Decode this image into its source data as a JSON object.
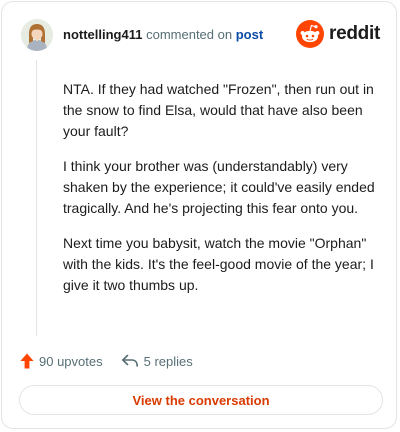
{
  "header": {
    "username": "nottelling411",
    "action_text": "commented on",
    "post_link_label": "post",
    "avatar_icon": "avatar-icon"
  },
  "brand": {
    "wordmark": "reddit",
    "logo_icon": "reddit-alien-logo-icon",
    "color": "#ff4500"
  },
  "comment": {
    "paragraphs": [
      "NTA. If they had watched \"Frozen\", then run out in the snow to find Elsa, would that have also been your fault?",
      "I think your brother was (understandably) very shaken by the experience; it could've easily ended tragically. And he's projecting this fear onto you.",
      "Next time you babysit, watch the movie \"Orphan\" with the kids. It's the feel-good movie of the year; I give it two thumbs up."
    ]
  },
  "meta": {
    "upvotes_label": "90 upvotes",
    "replies_label": "5 replies",
    "upvote_icon": "upvote-arrow-icon",
    "reply_icon": "reply-arrow-icon",
    "upvote_color": "#ff4500"
  },
  "actions": {
    "view_conversation_label": "View the conversation",
    "accent_color": "#d93a00"
  }
}
